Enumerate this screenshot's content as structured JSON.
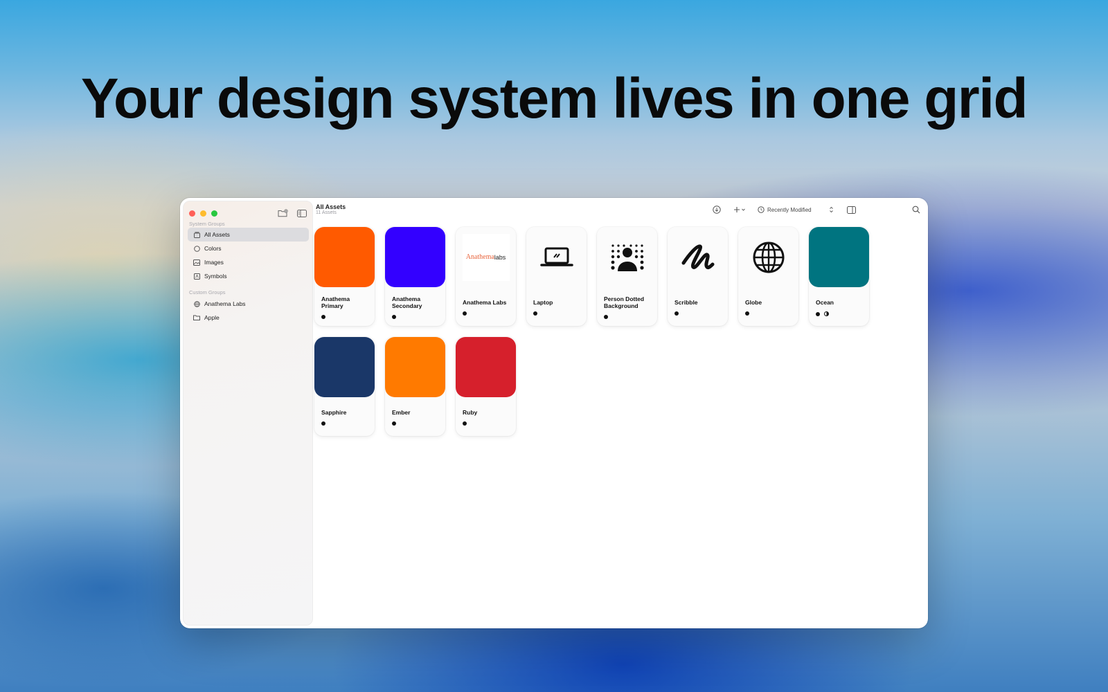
{
  "headline": "Your design system lives in one grid",
  "window": {
    "sidebar": {
      "system_groups_label": "System Groups",
      "system_items": [
        {
          "label": "All Assets",
          "icon": "collection-icon",
          "active": true
        },
        {
          "label": "Colors",
          "icon": "circle-icon"
        },
        {
          "label": "Images",
          "icon": "photo-icon"
        },
        {
          "label": "Symbols",
          "icon": "symbol-box-icon"
        }
      ],
      "custom_groups_label": "Custom Groups",
      "custom_items": [
        {
          "label": "Anathema Labs",
          "icon": "globe-icon"
        },
        {
          "label": "Apple",
          "icon": "folder-icon"
        }
      ]
    },
    "header": {
      "title": "All Assets",
      "subtitle": "11 Assets",
      "sort_label": "Recently Modified"
    },
    "assets": [
      {
        "name": "Anathema Primary",
        "kind": "color",
        "color": "#FF5A00",
        "modes": [
          "light"
        ]
      },
      {
        "name": "Anathema Secondary",
        "kind": "color",
        "color": "#3300FF",
        "modes": [
          "light"
        ]
      },
      {
        "name": "Anathema Labs",
        "kind": "image",
        "logo_text_a": "Anathema",
        "logo_text_b": "labs",
        "modes": [
          "light"
        ]
      },
      {
        "name": "Laptop",
        "kind": "symbol",
        "icon": "laptop-icon",
        "modes": [
          "light"
        ]
      },
      {
        "name": "Person Dotted Background",
        "kind": "symbol",
        "icon": "person-dotted-icon",
        "modes": [
          "light"
        ]
      },
      {
        "name": "Scribble",
        "kind": "symbol",
        "icon": "scribble-icon",
        "modes": [
          "light"
        ]
      },
      {
        "name": "Globe",
        "kind": "symbol",
        "icon": "globe-icon",
        "modes": [
          "light"
        ]
      },
      {
        "name": "Ocean",
        "kind": "color",
        "color": "#007480",
        "modes": [
          "light",
          "dark"
        ]
      },
      {
        "name": "Sapphire",
        "kind": "color",
        "color": "#1A3768",
        "modes": [
          "light"
        ]
      },
      {
        "name": "Ember",
        "kind": "color",
        "color": "#FF7A00",
        "modes": [
          "light"
        ]
      },
      {
        "name": "Ruby",
        "kind": "color",
        "color": "#D6202C",
        "modes": [
          "light"
        ]
      }
    ],
    "colors": {
      "close": "#FF5F57",
      "minimize": "#FEBC2E",
      "zoom": "#28C840",
      "logo_accent": "#E8643C"
    }
  }
}
